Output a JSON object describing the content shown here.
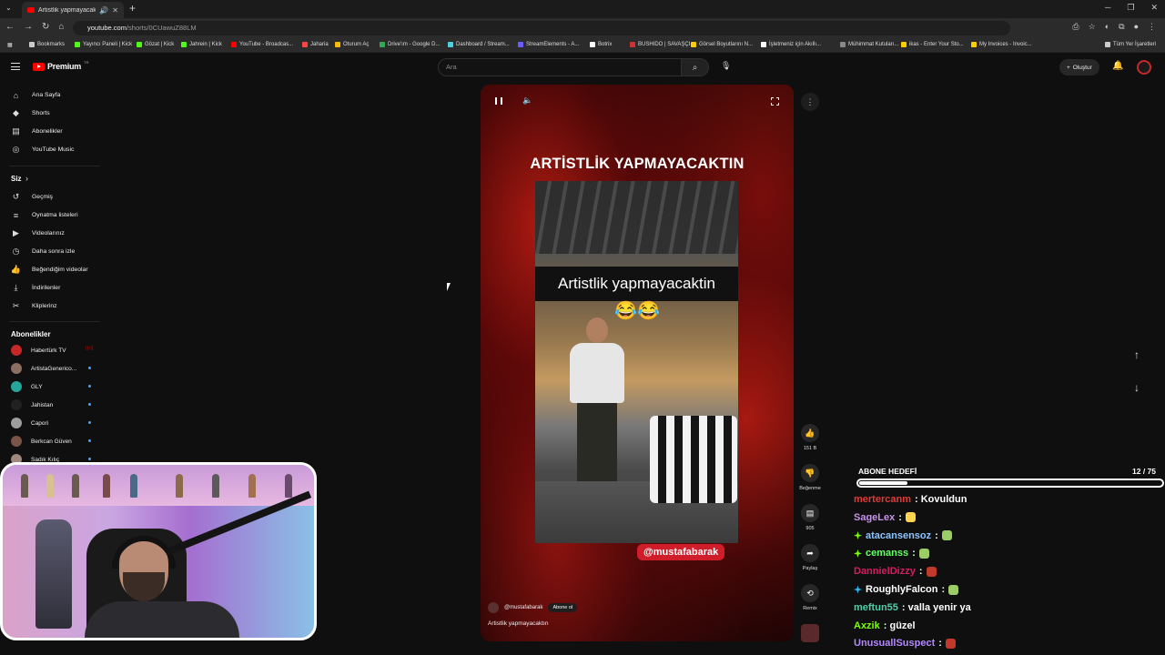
{
  "browser": {
    "tab_title": "Artistlik yapmayacaktın - YouTube",
    "url_host": "youtube.com",
    "url_path": "/shorts/0CUawuZ88LM",
    "bookmarks": [
      {
        "label": "Bookmarks",
        "color": "#cccccc"
      },
      {
        "label": "Yayıncı Paneli | Kick",
        "color": "#53fc18"
      },
      {
        "label": "Gözat | Kick",
        "color": "#53fc18"
      },
      {
        "label": "Jahrein | Kick",
        "color": "#53fc18"
      },
      {
        "label": "YouTube - Broadcas...",
        "color": "#ff0000"
      },
      {
        "label": "Jaharia",
        "color": "#ff4444"
      },
      {
        "label": "Oturum Aç",
        "color": "#fbbc05"
      },
      {
        "label": "Drive'ım - Google D...",
        "color": "#34a853"
      },
      {
        "label": "Dashboard / Stream...",
        "color": "#4dd0e1"
      },
      {
        "label": "StreamElements - A...",
        "color": "#6a5cff"
      },
      {
        "label": "Botrix",
        "color": "#ffffff"
      },
      {
        "label": "BUSHIDO | SAVAŞÇI...",
        "color": "#cc3333"
      },
      {
        "label": "Görsel Boyutlarını N...",
        "color": "#ffcc00"
      },
      {
        "label": "İşletmeniz için Akıllı...",
        "color": "#ffffff"
      },
      {
        "label": "Mühimmat Kutuları...",
        "color": "#888888"
      },
      {
        "label": "ikas - Enter Your Sto...",
        "color": "#ffcc00"
      },
      {
        "label": "My Invoices - Invoic...",
        "color": "#ffcc00"
      },
      {
        "label": "Tüm Yer İşaretleri",
        "color": "#cccccc"
      }
    ]
  },
  "header": {
    "logo_text": "Premium",
    "logo_superscript": "TR",
    "search_placeholder": "Ara",
    "create_label": "Oluştur"
  },
  "sidebar": {
    "main_items": [
      {
        "label": "Ana Sayfa",
        "icon": "home-icon",
        "glyph": "⌂"
      },
      {
        "label": "Shorts",
        "icon": "shorts-icon",
        "glyph": "◆"
      },
      {
        "label": "Abonelikler",
        "icon": "subscriptions-icon",
        "glyph": "▤"
      },
      {
        "label": "YouTube Music",
        "icon": "music-icon",
        "glyph": "◎"
      }
    ],
    "you_heading": "Siz",
    "you_items": [
      {
        "label": "Geçmiş",
        "icon": "history-icon",
        "glyph": "↺"
      },
      {
        "label": "Oynatma listeleri",
        "icon": "playlists-icon",
        "glyph": "≡"
      },
      {
        "label": "Videolarınız",
        "icon": "your-videos-icon",
        "glyph": "▶"
      },
      {
        "label": "Daha sonra izle",
        "icon": "watch-later-icon",
        "glyph": "◷"
      },
      {
        "label": "Beğendiğim videolar",
        "icon": "liked-icon",
        "glyph": "👍"
      },
      {
        "label": "İndirilenler",
        "icon": "downloads-icon",
        "glyph": "⤓"
      },
      {
        "label": "Kliplerinz",
        "icon": "clips-icon",
        "glyph": "✂"
      }
    ],
    "subs_heading": "Abonelikler",
    "subscriptions": [
      {
        "label": "Habertürk TV",
        "color": "#c62828",
        "live": true
      },
      {
        "label": "ArtistaGenerico...",
        "color": "#8d6e63",
        "live": false
      },
      {
        "label": "GLY",
        "color": "#26a69a",
        "live": false
      },
      {
        "label": "Jahistan",
        "color": "#212121",
        "live": false
      },
      {
        "label": "Capori",
        "color": "#9e9e9e",
        "live": false
      },
      {
        "label": "Berkcan Güven",
        "color": "#795548",
        "live": false
      },
      {
        "label": "Sadık Kılıç",
        "color": "#a1887f",
        "live": false
      }
    ]
  },
  "short": {
    "headline": "ARTİSTLİK YAPMAYACAKTIN",
    "caption": "Artistlik yapmayacaktin",
    "emojis": "😂😂",
    "handle_tag": "@mustafabarak",
    "channel": "@mustafabarak",
    "subscribe_label": "Abone ol",
    "description": "Artistlik yapmayacaktın",
    "likes": "151 B",
    "dislike_label": "Beğenme",
    "comments": "905",
    "share_label": "Paylaş",
    "remix_label": "Remix"
  },
  "overlay": {
    "goal_label": "ABONE HEDEFİ",
    "goal_count": "12 / 75",
    "goal_progress": 0.16,
    "chat": [
      {
        "user": "mertercanm",
        "color": "#e53935",
        "message": ": Kovuldun",
        "emote": null,
        "badge": null
      },
      {
        "user": "SageLex",
        "color": "#c792ea",
        "message": ":",
        "emote": "#ffd54f",
        "badge": null
      },
      {
        "user": "atacansensoz",
        "color": "#8ec5ff",
        "message": ":",
        "emote": "#9ccc65",
        "badge": "#7cfc00"
      },
      {
        "user": "cemanss",
        "color": "#66ff66",
        "message": ":",
        "emote": "#9ccc65",
        "badge": "#7cfc00"
      },
      {
        "user": "DannielDizzy",
        "color": "#d81b60",
        "message": ":",
        "emote": "#c0392b",
        "badge": null
      },
      {
        "user": "RoughlyFalcon",
        "color": "#ffffff",
        "message": ":",
        "emote": "#9ccc65",
        "badge": "#29b6f6"
      },
      {
        "user": "meftun55",
        "color": "#4dd0a8",
        "message": ": valla yenir ya",
        "emote": null,
        "badge": null
      },
      {
        "user": "Axzik",
        "color": "#7cfc00",
        "message": ": güzel",
        "emote": null,
        "badge": null
      },
      {
        "user": "UnusuallSuspect",
        "color": "#b388ff",
        "message": ":",
        "emote": "#c0392b",
        "badge": null
      }
    ]
  }
}
